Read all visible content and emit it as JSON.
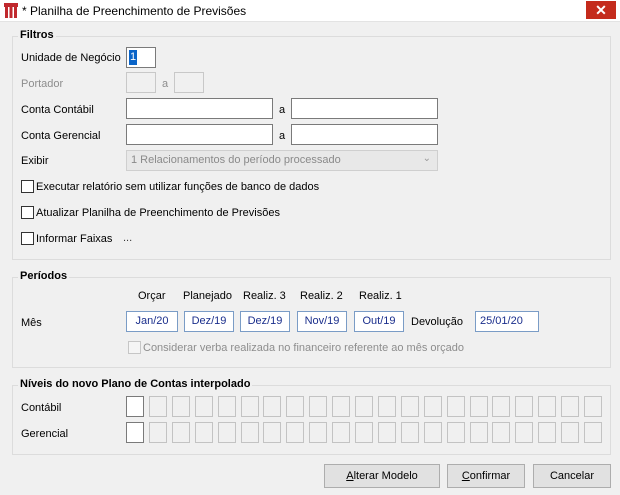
{
  "window": {
    "title": "* Planilha de Preenchimento de Previsões",
    "close_glyph": "✕"
  },
  "filtros": {
    "title": "Filtros",
    "unidade_label": "Unidade de Negócio",
    "unidade_value": "1",
    "portador_label": "Portador",
    "a_label": "a",
    "conta_contabil_label": "Conta Contábil",
    "conta_gerencial_label": "Conta Gerencial",
    "exibir_label": "Exibir",
    "exibir_value": "1 Relacionamentos do período processado",
    "cb_executar": "Executar relatório sem utilizar funções de banco de dados",
    "cb_atualizar": "Atualizar Planilha de Preenchimento de Previsões",
    "cb_faixas": "Informar Faixas",
    "faixas_ellipsis": "..."
  },
  "periodos": {
    "title": "Períodos",
    "headers": [
      "Orçar",
      "Planejado",
      "Realiz. 3",
      "Realiz. 2",
      "Realiz. 1"
    ],
    "mes_label": "Mês",
    "values": [
      "Jan/20",
      "Dez/19",
      "Dez/19",
      "Nov/19",
      "Out/19"
    ],
    "devolucao_label": "Devolução",
    "devolucao_value": "25/01/20",
    "considerar_label": "Considerar verba realizada no financeiro referente ao mês orçado"
  },
  "niveis": {
    "title": "Níveis do novo Plano de Contas interpolado",
    "contabil_label": "Contábil",
    "gerencial_label": "Gerencial"
  },
  "buttons": {
    "alterar_u": "A",
    "alterar_rest": "lterar Modelo",
    "confirmar_u": "C",
    "confirmar_rest": "onfirmar",
    "cancelar": "Cancelar"
  }
}
